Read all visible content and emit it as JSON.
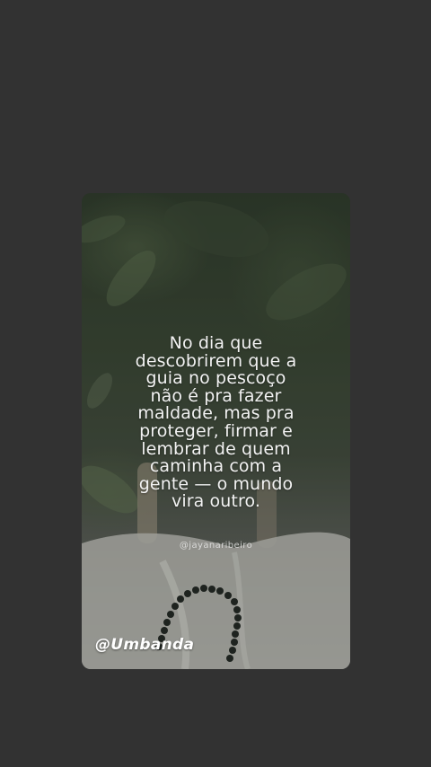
{
  "story": {
    "quote_lines": [
      "No dia que",
      "descobrirem que a",
      "guia no pescoço",
      "não é pra fazer",
      "maldade, mas pra",
      "proteger, firmar e",
      "lembrar de quem",
      "caminha com a",
      "gente — o mundo",
      "vira outro."
    ],
    "author_handle": "@jayanaribeiro",
    "sticker_tag": "@Umbanda"
  },
  "colors": {
    "background": "#323232",
    "text": "#f2f2f2"
  }
}
